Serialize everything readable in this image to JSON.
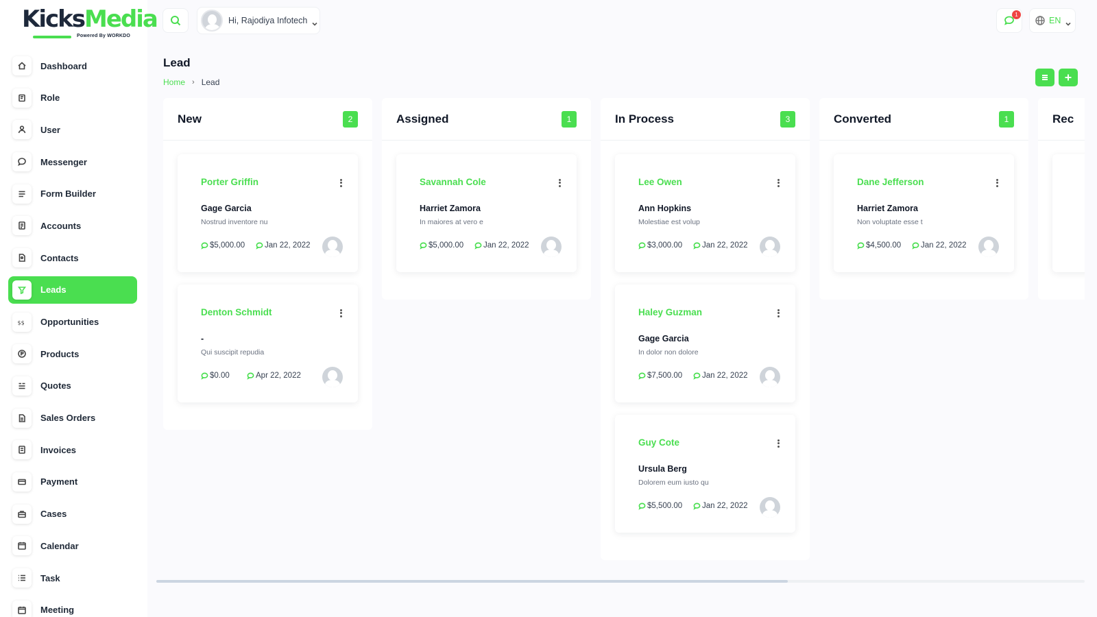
{
  "logo": {
    "part1": "Kicks",
    "part2": "Media",
    "powered": "Powered By ",
    "powered_brand": "WORKDO"
  },
  "sidebar": {
    "items": [
      {
        "label": "Dashboard",
        "icon": "home-icon"
      },
      {
        "label": "Role",
        "icon": "role-icon"
      },
      {
        "label": "User",
        "icon": "user-icon"
      },
      {
        "label": "Messenger",
        "icon": "messenger-icon"
      },
      {
        "label": "Form Builder",
        "icon": "form-builder-icon"
      },
      {
        "label": "Accounts",
        "icon": "accounts-icon"
      },
      {
        "label": "Contacts",
        "icon": "contacts-icon"
      },
      {
        "label": "Leads",
        "icon": "leads-icon",
        "active": true
      },
      {
        "label": "Opportunities",
        "icon": "opportunities-icon"
      },
      {
        "label": "Products",
        "icon": "products-icon"
      },
      {
        "label": "Quotes",
        "icon": "quotes-icon"
      },
      {
        "label": "Sales Orders",
        "icon": "sales-orders-icon"
      },
      {
        "label": "Invoices",
        "icon": "invoices-icon"
      },
      {
        "label": "Payment",
        "icon": "payment-icon"
      },
      {
        "label": "Cases",
        "icon": "cases-icon"
      },
      {
        "label": "Calendar",
        "icon": "calendar-icon"
      },
      {
        "label": "Task",
        "icon": "task-icon"
      },
      {
        "label": "Meeting",
        "icon": "meeting-icon"
      }
    ]
  },
  "topbar": {
    "greeting": "Hi, Rajodiya Infotech",
    "notification_count": "1",
    "language": "EN"
  },
  "page": {
    "title": "Lead",
    "breadcrumb_home": "Home",
    "breadcrumb_current": "Lead"
  },
  "colors": {
    "accent": "#4ade50",
    "badge": "#ef4444"
  },
  "board": {
    "columns": [
      {
        "title": "New",
        "count": "2",
        "cards": [
          {
            "name": "Porter Griffin",
            "company": "Gage Garcia",
            "note": "Nostrud inventore nu",
            "amount": "$5,000.00",
            "date": "Jan 22, 2022"
          },
          {
            "name": "Denton Schmidt",
            "company": "-",
            "note": "Qui suscipit repudia",
            "amount": "$0.00",
            "date": "Apr 22, 2022"
          }
        ]
      },
      {
        "title": "Assigned",
        "count": "1",
        "cards": [
          {
            "name": "Savannah Cole",
            "company": "Harriet Zamora",
            "note": "In maiores at vero e",
            "amount": "$5,000.00",
            "date": "Jan 22, 2022"
          }
        ]
      },
      {
        "title": "In Process",
        "count": "3",
        "cards": [
          {
            "name": "Lee Owen",
            "company": "Ann Hopkins",
            "note": "Molestiae est volup",
            "amount": "$3,000.00",
            "date": "Jan 22, 2022"
          },
          {
            "name": "Haley Guzman",
            "company": "Gage Garcia",
            "note": "In dolor non dolore",
            "amount": "$7,500.00",
            "date": "Jan 22, 2022"
          },
          {
            "name": "Guy Cote",
            "company": "Ursula Berg",
            "note": "Dolorem eum iusto qu",
            "amount": "$5,500.00",
            "date": "Jan 22, 2022"
          }
        ]
      },
      {
        "title": "Converted",
        "count": "1",
        "cards": [
          {
            "name": "Dane Jefferson",
            "company": "Harriet Zamora",
            "note": "Non voluptate esse t",
            "amount": "$4,500.00",
            "date": "Jan 22, 2022"
          }
        ]
      },
      {
        "title": "Rec",
        "count": "",
        "cards": [
          {
            "name": "",
            "company": "",
            "note": "",
            "amount": "",
            "date": ""
          }
        ]
      }
    ]
  },
  "scroll": {
    "visible_fraction": 0.68
  }
}
